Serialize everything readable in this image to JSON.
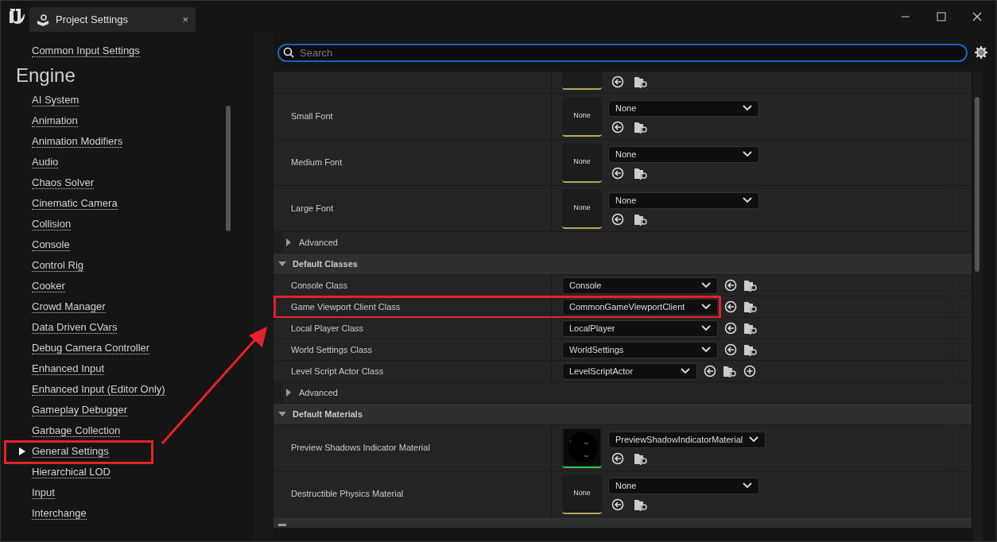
{
  "window": {
    "tab_title": "Project Settings",
    "tab_close": "×"
  },
  "sidebar": {
    "items_above": [
      {
        "label": "Common Input Settings",
        "selected": false,
        "highlighted": false
      }
    ],
    "heading": "Engine",
    "items": [
      {
        "label": "AI System",
        "selected": false,
        "highlighted": false
      },
      {
        "label": "Animation",
        "selected": false,
        "highlighted": false
      },
      {
        "label": "Animation Modifiers",
        "selected": false,
        "highlighted": false
      },
      {
        "label": "Audio",
        "selected": false,
        "highlighted": false
      },
      {
        "label": "Chaos Solver",
        "selected": false,
        "highlighted": false
      },
      {
        "label": "Cinematic Camera",
        "selected": false,
        "highlighted": false
      },
      {
        "label": "Collision",
        "selected": false,
        "highlighted": false
      },
      {
        "label": "Console",
        "selected": false,
        "highlighted": false
      },
      {
        "label": "Control Rig",
        "selected": false,
        "highlighted": false
      },
      {
        "label": "Cooker",
        "selected": false,
        "highlighted": false
      },
      {
        "label": "Crowd Manager",
        "selected": false,
        "highlighted": false
      },
      {
        "label": "Data Driven CVars",
        "selected": false,
        "highlighted": false
      },
      {
        "label": "Debug Camera Controller",
        "selected": false,
        "highlighted": false
      },
      {
        "label": "Enhanced Input",
        "selected": false,
        "highlighted": false
      },
      {
        "label": "Enhanced Input (Editor Only)",
        "selected": false,
        "highlighted": false
      },
      {
        "label": "Gameplay Debugger",
        "selected": false,
        "highlighted": false
      },
      {
        "label": "Garbage Collection",
        "selected": false,
        "highlighted": false
      },
      {
        "label": "General Settings",
        "selected": true,
        "highlighted": true
      },
      {
        "label": "Hierarchical LOD",
        "selected": false,
        "highlighted": false
      },
      {
        "label": "Input",
        "selected": false,
        "highlighted": false
      },
      {
        "label": "Interchange",
        "selected": false,
        "highlighted": false
      }
    ]
  },
  "search": {
    "placeholder": "Search"
  },
  "details": [
    {
      "kind": "asset-cropped"
    },
    {
      "kind": "asset",
      "label": "Small Font",
      "thumbnail": "None",
      "value": "None"
    },
    {
      "kind": "asset",
      "label": "Medium Font",
      "thumbnail": "None",
      "value": "None"
    },
    {
      "kind": "asset",
      "label": "Large Font",
      "thumbnail": "None",
      "value": "None"
    },
    {
      "kind": "group",
      "label": "Advanced",
      "expanded": false
    },
    {
      "kind": "category",
      "label": "Default Classes",
      "expanded": true
    },
    {
      "kind": "class",
      "label": "Console Class",
      "value": "Console",
      "addable": false,
      "highlighted": false
    },
    {
      "kind": "class",
      "label": "Game Viewport Client Class",
      "value": "CommonGameViewportClient",
      "addable": false,
      "highlighted": true
    },
    {
      "kind": "class",
      "label": "Local Player Class",
      "value": "LocalPlayer",
      "addable": false,
      "highlighted": false
    },
    {
      "kind": "class",
      "label": "World Settings Class",
      "value": "WorldSettings",
      "addable": false,
      "highlighted": false
    },
    {
      "kind": "class",
      "label": "Level Script Actor Class",
      "value": "LevelScriptActor",
      "addable": true,
      "highlighted": false
    },
    {
      "kind": "group",
      "label": "Advanced",
      "expanded": false
    },
    {
      "kind": "category",
      "label": "Default Materials",
      "expanded": true
    },
    {
      "kind": "asset",
      "label": "Preview Shadows Indicator Material",
      "value": "PreviewShadowIndicatorMaterial"
    },
    {
      "kind": "asset",
      "label": "Destructible Physics Material",
      "thumbnail": "None",
      "value": "None"
    },
    {
      "kind": "category-cropped"
    }
  ]
}
